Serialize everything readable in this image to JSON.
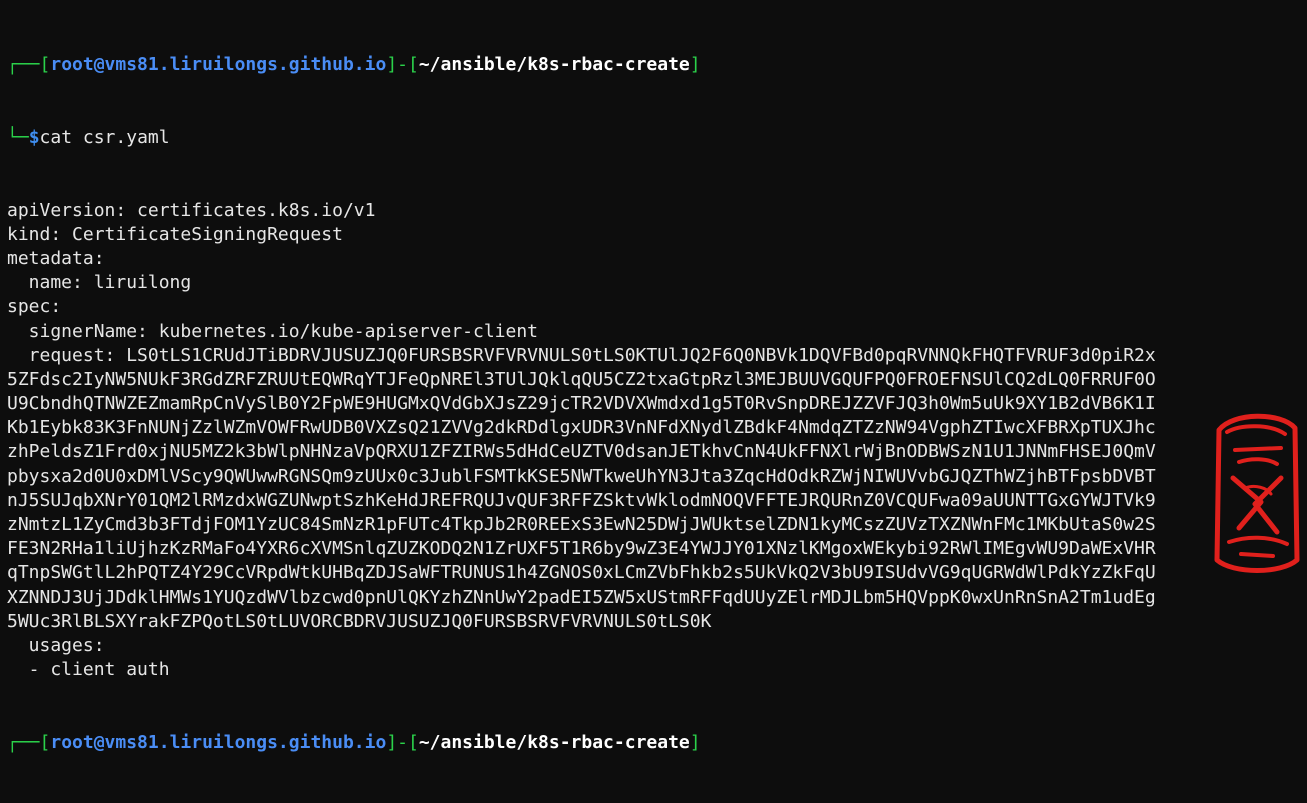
{
  "prompt": {
    "user_host": "root@vms81.liruilongs.github.io",
    "cwd": "~/ansible/k8s-rbac-create",
    "symbol": "$"
  },
  "commands": {
    "first": "cat csr.yaml"
  },
  "output_lines": [
    "apiVersion: certificates.k8s.io/v1",
    "kind: CertificateSigningRequest",
    "metadata:",
    "  name: liruilong",
    "spec:",
    "  signerName: kubernetes.io/kube-apiserver-client",
    "  request: LS0tLS1CRUdJTiBDRVJUSUZJQ0FURSBSRVFVRVNULS0tLS0KTUlJQ2F6Q0NBVk1DQVFBd0pqRVNNQkFHQTFVRUF3d0piR2x",
    "5ZFdsc2IyNW5NUkF3RGdZRFZRUUtEQWRqYTJFeQpNREl3TUlJQklqQU5CZ2txaGtpRzl3MEJBUUVGQUFPQ0FROEFNSUlCQ2dLQ0FRRUF0O",
    "U9CbndhQTNWZEZmamRpCnVySlB0Y2FpWE9HUGMxQVdGbXJsZ29jcTR2VDVXWmdxd1g5T0RvSnpDREJZZVFJQ3h0Wm5uUk9XY1B2dVB6K1I",
    "Kb1Eybk83K3FnNUNjZzlWZmVOWFRwUDB0VXZsQ21ZVVg2dkRDdlgxUDR3VnNFdXNydlZBdkF4NmdqZTZzNW94VgphZTIwcXFBRXpTUXJhc",
    "zhPeldsZ1Frd0xjNU5MZ2k3bWlpNHNzaVpQRXU1ZFZIRWs5dHdCeUZTV0dsanJETkhvCnN4UkFFNXlrWjBnODBWSzN1U1JNNmFHSEJ0QmV",
    "pbysxa2d0U0xDMlVScy9QWUwwRGNSQm9zUUx0c3JublFSMTkKSE5NWTkweUhYN3Jta3ZqcHdOdkRZWjNIWUVvbGJQZThWZjhBTFpsbDVBT",
    "nJ5SUJqbXNrY01QM2lRMzdxWGZUNwptSzhKeHdJREFRQUJvQUF3RFFZSktvWklodmNOQVFFTEJRQURnZ0VCQUFwa09aUUNTTGxGYWJTVk9",
    "zNmtzL1ZyCmd3b3FTdjFOM1YzUC84SmNzR1pFUTc4TkpJb2R0REExS3EwN25DWjJWUktselZDN1kyMCszZUVzTXZNWnFMc1MKbUtaS0w2S",
    "FE3N2RHa1liUjhzKzRMaFo4YXR6cXVMSnlqZUZKODQ2N1ZrUXF5T1R6by9wZ3E4YWJJY01XNzlKMgoxWEkybi92RWlIMEgvWU9DaWExVHR",
    "qTnpSWGtlL2hPQTZ4Y29CcVRpdWtkUHBqZDJSaWFTRUNUS1h4ZGNOS0xLCmZVbFhkb2s5UkVkQ2V3bU9ISUdvVG9qUGRWdWlPdkYzZkFqU",
    "XZNNDJ3UjJDdklHMWs1YUQzdWVlbzcwd0pnUlQKYzhZNnUwY2padEI5ZW5xUStmRFFqdUUyZElrMDJLbm5HQVppK0wxUnRnSnA2Tm1udEg",
    "5WUc3RlBLSXYrakFZPQotLS0tLUVORCBDRVJUSUZJQ0FURSBSRVFVRVNULS0tLS0K",
    "  usages:",
    "  - client auth"
  ],
  "colors": {
    "background": "#0d0d0d",
    "prompt_frame": "#2bd14a",
    "user_host": "#4a8df5",
    "text": "#e6e6e6",
    "seal": "#e0201c"
  }
}
